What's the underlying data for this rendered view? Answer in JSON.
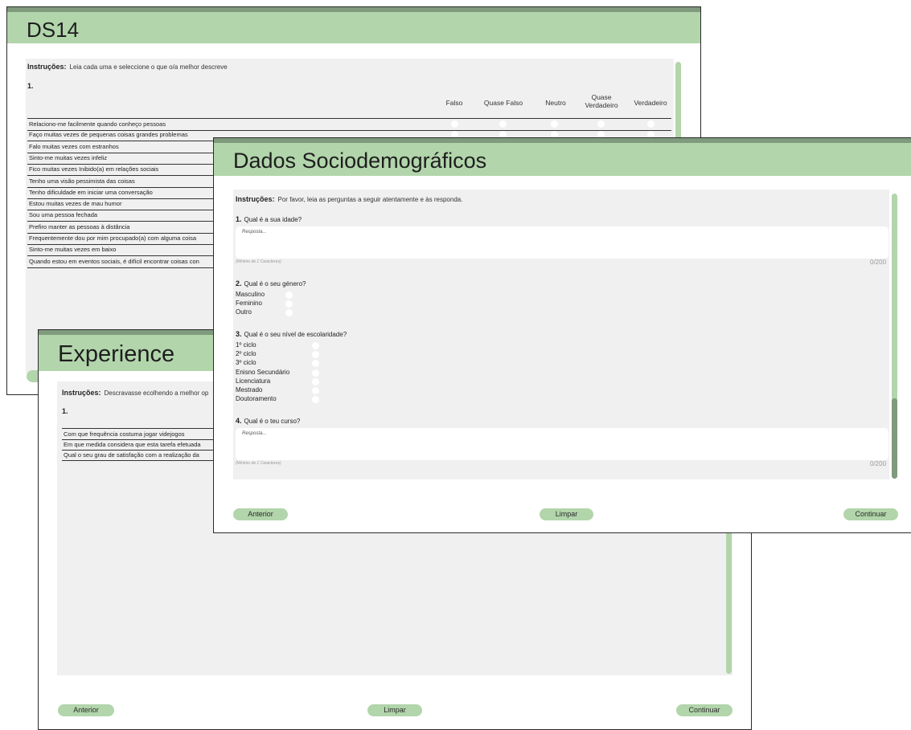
{
  "ds14": {
    "title": "DS14",
    "instructions_label": "Instruções:",
    "instructions_text": "Leia cada uma e seleccione o que o/a melhor descreve",
    "question_number": "1.",
    "columns": [
      "Falso",
      "Quase Falso",
      "Neutro",
      "Quase Verdadeiro",
      "Verdadeiro"
    ],
    "rows": [
      "Relaciono-me facilmente quando conheço pessoas",
      "Faço muitas vezes de pequenas coisas grandes problemas",
      "Falo muitas vezes com estranhos",
      "Sinto-me muitas vezes infeliz",
      "Fico muitas vezes Inibido(a) em relações sociais",
      "Tenho uma visão pessimista das coisas",
      "Tenho dificuldade em iniciar uma conversação",
      "Estou muitas vezes de mau humor",
      "Sou uma pessoa fechada",
      "Prefiro manter as pessoas à distância",
      "Frequentemente dou por mim procupado(a) com alguma coisa",
      "Sinto-me muitas vezes em baixo",
      "Quando estou em eventos sociais, é difícil encontrar coisas con"
    ]
  },
  "experience": {
    "title": "Experience",
    "instructions_label": "Instruções:",
    "instructions_text": "Descravasse ecolhendo a melhor op",
    "question_number": "1.",
    "rows": [
      "Com que frequência costuma jogar videjogos",
      "Em que medida considera que esta tarefa efetuada",
      "Qual o seu grau de satisfação com a realização da"
    ],
    "buttons": {
      "prev": "Anterior",
      "clear": "Limpar",
      "next": "Continuar"
    }
  },
  "demo": {
    "title": "Dados Sociodemográficos",
    "instructions_label": "Instruções:",
    "instructions_text": "Por favor, leia as perguntas a seguir atentamente e às responda.",
    "q1": {
      "number": "1.",
      "text": "Qual é a sua idade?",
      "placeholder": "Resposta...",
      "hint": "(Mínimo de 1 Caracteres)",
      "counter": "0/200"
    },
    "q2": {
      "number": "2.",
      "text": "Qual é o seu género?",
      "options": [
        "Masculino",
        "Feminino",
        "Outro"
      ]
    },
    "q3": {
      "number": "3.",
      "text": "Qual é o seu nível de escolaridade?",
      "options": [
        "1º ciclo",
        "2º ciclo",
        "3º ciclo",
        "Enisno Secundário",
        "Licenciatura",
        "Mestrado",
        "Doutoramento"
      ]
    },
    "q4": {
      "number": "4.",
      "text": "Qual é o teu curso?",
      "placeholder": "Resposta...",
      "hint": "(Mínimo de 1 Caracteres)",
      "counter": "0/200"
    },
    "buttons": {
      "prev": "Anterior",
      "clear": "Limpar",
      "next": "Continuar"
    }
  },
  "colors": {
    "header": "#b2d5ab",
    "accent_dark": "#7f9a7c",
    "panel": "#f0f0f0"
  }
}
